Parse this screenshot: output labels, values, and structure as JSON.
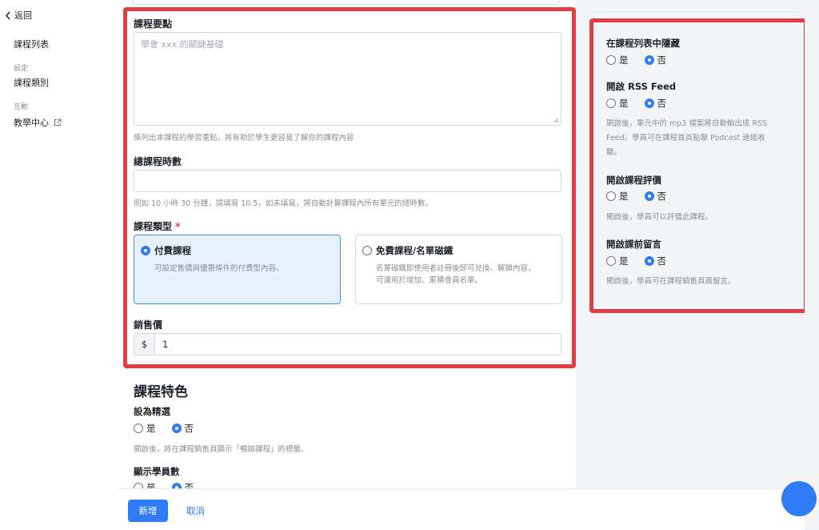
{
  "sidebar": {
    "back_label": "返回",
    "items": [
      {
        "label": "課程列表"
      },
      {
        "group": "設定"
      },
      {
        "label": "課程類別"
      },
      {
        "group": "互動"
      },
      {
        "label": "教學中心"
      }
    ]
  },
  "form": {
    "highlights_label": "課程要點",
    "highlights_placeholder": "學會 xxx 的關鍵基礎",
    "highlights_help": "條列出本課程的學習重點，將有助於學生更容易了解你的課程內容",
    "hours_label": "總課程時數",
    "hours_help": "例如 10 小時 30 分鐘，請填寫 10.5，如未填寫，將自動計算課程內所有單元的總時數。",
    "type_label": "課程類型",
    "required_mark": "*",
    "paid": {
      "title": "付費課程",
      "desc": "可設定售價與優惠條件的付費型內容。",
      "selected": true
    },
    "free": {
      "title": "免費課程/名單磁鐵",
      "desc_line1": "名單磁鐵即使用者註冊後即可兌換、解鎖內容，",
      "desc_line2": "可運用於增加、累積會員名單。",
      "selected": false
    },
    "price_label": "銷售價",
    "price_prefix": "$",
    "price_value": "1"
  },
  "features": {
    "title": "課程特色",
    "featured_label": "設為精選",
    "featured_yes": "是",
    "featured_no": "否",
    "featured_value": "否",
    "featured_help": "開啟後，將在課程銷售頁顯示「暢銷課程」的標籤。",
    "students_label": "顯示學員數",
    "students_yes": "是",
    "students_no": "否",
    "students_value": "否"
  },
  "settings": {
    "hide": {
      "label": "在課程列表中隱藏",
      "yes": "是",
      "no": "否",
      "value": "否"
    },
    "rss": {
      "label": "開啟 RSS Feed",
      "yes": "是",
      "no": "否",
      "value": "否",
      "help_line1": "開啟後，單元中的 mp3 檔案將自動輸出成 RSS",
      "help_line2": "Feed。學員可在課程首頁點擊 Podcast 連結收",
      "help_line3": "聽。"
    },
    "rating": {
      "label": "開啟課程評價",
      "yes": "是",
      "no": "否",
      "value": "否",
      "help": "開啟後，學員可以評價此課程。"
    },
    "comment": {
      "label": "開啟課前留言",
      "yes": "是",
      "no": "否",
      "value": "否",
      "help": "開啟後，學員可在課程銷售頁面留言。"
    }
  },
  "footer": {
    "submit_label": "新增",
    "cancel_label": "取消"
  },
  "colors": {
    "accent": "#2f7cf6",
    "highlight_border": "#e23c44",
    "selected_card_bg": "#e6f1fe"
  }
}
